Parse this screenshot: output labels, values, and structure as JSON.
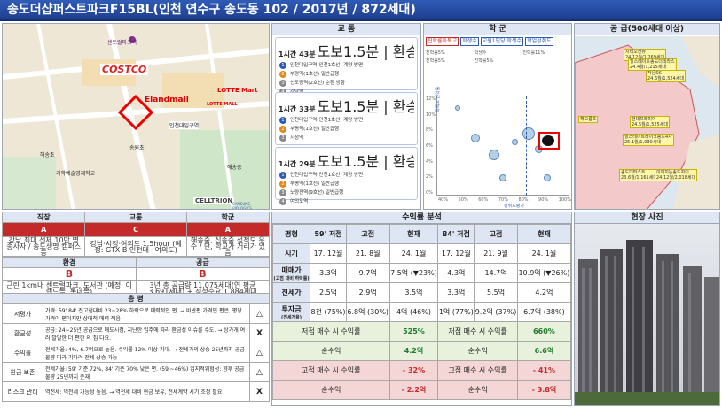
{
  "title": "송도더샵퍼스트파크F15BL(인천 연수구 송도동 102 / 2017년 / 872세대)",
  "panels": {
    "transport": "교 통",
    "school": "학 군",
    "supply": "공 급(500세대 이상)",
    "analysis": "수익률 분석",
    "photo": "현장 사진"
  },
  "map": {
    "labels": [
      "센트럴파크역",
      "COSTCO",
      "Elandmall",
      "LOTTE Mart",
      "LOTTE MALL",
      "인천대입구역",
      "송원초",
      "해송초",
      "과학예술영재학교",
      "해송중",
      "CELLTRION",
      "SAMSUNG BIOLOGICS"
    ]
  },
  "transport": {
    "routes": [
      {
        "time": "1시간 43분",
        "meta": "도보1.5분 | 환승2회 | 요금 2,200원",
        "steps": [
          "인천대입구역(인천1호선) 계양 방면",
          "부평역(1호선) 일반급행",
          "신도림역(2호선) 순환 방향",
          "강남역"
        ]
      },
      {
        "time": "1시간 33분",
        "meta": "도보1.5분 | 환승1회 | 요금 2,100원",
        "steps": [
          "인천대입구역(인천1호선) 계양 방면",
          "부평역(1호선) 일반급행",
          "시청역"
        ]
      },
      {
        "time": "1시간 29분",
        "meta": "도보1.5분 | 환승2회 | 요금 2,000원",
        "steps": [
          "인천대입구역(인천1호선) 계양 방면",
          "부평역(1호선) 일반급행",
          "노량진역(9호선) 일반급행",
          "여의도역"
        ]
      }
    ]
  },
  "school": {
    "pills": [
      "진학률특목고",
      "학생수",
      "교원1인당 학생수",
      "학업성취도"
    ],
    "lines": [
      "진학률5%",
      "학생수",
      "진학률11%",
      "진학률5%",
      "진학률5%"
    ],
    "yticks": [
      "12%",
      "10%",
      "8%",
      "6%",
      "4%",
      "2%",
      "0%"
    ],
    "xticks": [
      "40%",
      "50%",
      "60%",
      "70%",
      "80%",
      "90%",
      "100%"
    ],
    "xlabel": "성취도평가",
    "ylabel": "특목고 진학률"
  },
  "supply": {
    "tags": [
      {
        "name": "시티오션뷰",
        "date": "24.12월/1,269세대"
      },
      {
        "name": "힐스테이트송도더테라스",
        "date": "24.4월/1,215세대"
      },
      {
        "name": "현대프레미어",
        "date": "24.5월/1,525세대"
      },
      {
        "name": "힐스테이트레이크송도4차",
        "date": "25.1월/1,030세대"
      },
      {
        "name": "해오름초",
        "date": ""
      },
      {
        "name": "송도더퍼스트",
        "date": "23.6월/1,161세대"
      },
      {
        "name": "이어지는송도자이",
        "date": "24.12월/2,018세대"
      },
      {
        "name": "작은SK",
        "date": "24.6월/1,524세대"
      }
    ]
  },
  "summary": {
    "headers": [
      "직장",
      "교통",
      "학군"
    ],
    "grades": [
      "A",
      "C",
      "A"
    ],
    "notes": [
      "강남 최대 선제 10만 명 종사자 / 송도생명 캠퍼스 등",
      "강남·시청·여의도 1.5hour (예정: GTX B 인천대~여의도)",
      "해송중, 신송중 성적도 우수 / 단, 학교가 거리가 있음"
    ],
    "headers2": [
      "환경",
      "공급"
    ],
    "grades2": [
      "B",
      "B"
    ],
    "notes2": [
      "근린 1km내 센트럴파크, 도서관 (예정: 이랜드몰, 롯데몰)",
      "3년 총 공급량 11,075세대(연 평균 3,691세대) + 적정수요 1,884세대"
    ]
  },
  "evaluation": {
    "title": "총 평",
    "rows": [
      {
        "k": "저평가",
        "text": "가격: 59' 84' 전고점대비 23~28% 하락으로 매력적인 편. → 비싼편 가격인 편은, 평당 가격이 편이지만 상대적 매력 적음",
        "v": "△"
      },
      {
        "k": "환금성",
        "text": "공급: 24~25년 공급으로 매도시점, 지난한 입주에 따라 환금성 이슈를 수도. → 상가개 여러 발달한 더 편한 의 집 다요.",
        "v": "X"
      },
      {
        "k": "수익률",
        "text": "전세가율: 4%, 6.7억으로 높음. 수익률 12% 이상 기대. → 전세가의 상승 25년까지 공급물량 따라 기다려 전세 상승 가능",
        "v": "△"
      },
      {
        "k": "원금 보존",
        "text": "전세가율: 59' 기준 72%, 84' 기준 70% 낮은 편. (59'~46%) 입지적위험성: 향후 공급물량 25년까지 존재",
        "v": "△"
      },
      {
        "k": "리스크 관리",
        "text": "역전세: 역전세 가능성 높음. → 역전세 대비 현금 보유, 전세계약 시기 조정 필요",
        "v": "X"
      }
    ]
  },
  "analysis": {
    "headers": [
      "평형",
      "59' 저점",
      "고점",
      "현재",
      "84' 저점",
      "고점",
      "현재"
    ],
    "rows": [
      {
        "label": "시기",
        "cells": [
          "17. 12월",
          "21. 8월",
          "24. 1월",
          "17. 12월",
          "21. 9월",
          "24. 1월"
        ]
      },
      {
        "label": "매매가",
        "sublabel": "(고점 대비 하락률)",
        "cells": [
          "3.3억",
          "9.7억",
          "7.5억 (▼23%)",
          "4.3억",
          "14.7억",
          "10.9억 (▼26%)"
        ]
      },
      {
        "label": "전세가",
        "cells": [
          "2.5억",
          "2.9억",
          "3.5억",
          "3.3억",
          "5.5억",
          "4.2억"
        ]
      },
      {
        "label": "투자금",
        "sublabel": "(전세가율)",
        "cells": [
          "8천 (75%)",
          "6.8억 (30%)",
          "4억 (46%)",
          "1억 (77%)",
          "9.2억 (37%)",
          "6.7억 (38%)"
        ]
      }
    ],
    "low_buy_label": "저점 매수 시 수익률",
    "low_59": "525%",
    "low_84": "660%",
    "net_label": "순수익",
    "net_59": "4.2억",
    "net_84": "6.6억",
    "high_buy_label": "고점 매수 시 수익률",
    "high_59": "- 32%",
    "high_84": "- 41%",
    "net2_59": "- 2.2억",
    "net2_84": "- 3.8억"
  }
}
